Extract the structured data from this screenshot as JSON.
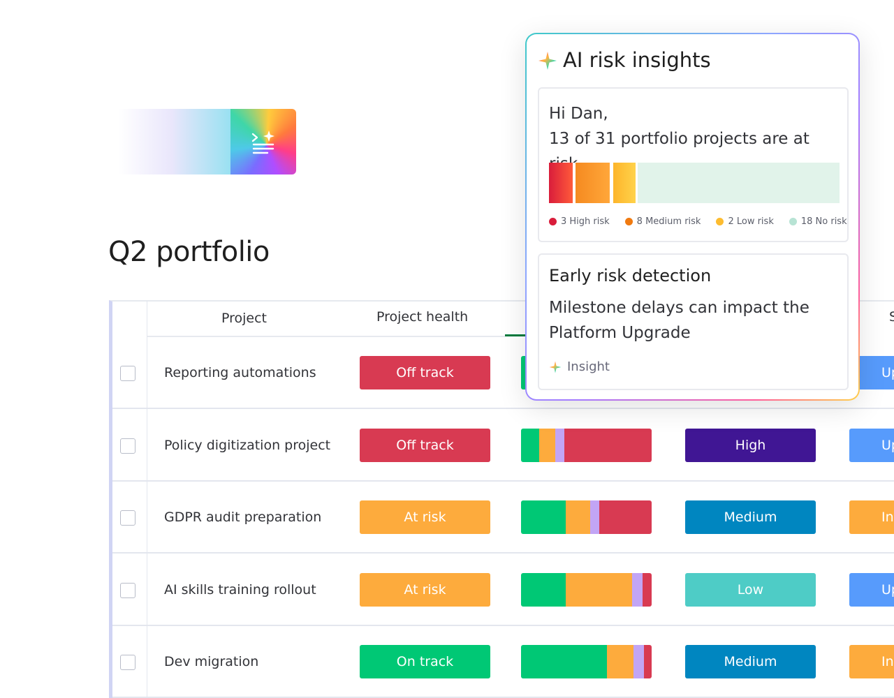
{
  "page": {
    "title": "Q2 portfolio"
  },
  "table": {
    "headers": {
      "project": "Project",
      "health": "Project health",
      "last": "S"
    },
    "rows": [
      {
        "name": "Reporting automations",
        "health": "Off track",
        "health_color": "#d83a52",
        "bar": [
          {
            "c": "#00c875",
            "w": 1
          }
        ],
        "priority": "",
        "priority_color": "",
        "status": "Up",
        "status_color": "#579bfc"
      },
      {
        "name": "Policy digitization project",
        "health": "Off track",
        "health_color": "#d83a52",
        "bar": [
          {
            "c": "#00c875",
            "w": 14
          },
          {
            "c": "#fdab3d",
            "w": 12
          },
          {
            "c": "#c2a5f5",
            "w": 7
          },
          {
            "c": "#d83a52",
            "w": 67
          }
        ],
        "priority": "High",
        "priority_color": "#401694",
        "status": "Up",
        "status_color": "#579bfc"
      },
      {
        "name": "GDPR audit preparation",
        "health": "At risk",
        "health_color": "#fdab3d",
        "bar": [
          {
            "c": "#00c875",
            "w": 34
          },
          {
            "c": "#fdab3d",
            "w": 19
          },
          {
            "c": "#c2a5f5",
            "w": 7
          },
          {
            "c": "#d83a52",
            "w": 40
          }
        ],
        "priority": "Medium",
        "priority_color": "#0086c0",
        "status": "In",
        "status_color": "#fdab3d"
      },
      {
        "name": "AI skills training rollout",
        "health": "At risk",
        "health_color": "#fdab3d",
        "bar": [
          {
            "c": "#00c875",
            "w": 34
          },
          {
            "c": "#fdab3d",
            "w": 51
          },
          {
            "c": "#c2a5f5",
            "w": 8
          },
          {
            "c": "#d83a52",
            "w": 7
          }
        ],
        "priority": "Low",
        "priority_color": "#4eccc6",
        "status": "Up",
        "status_color": "#579bfc"
      },
      {
        "name": "Dev migration",
        "health": "On track",
        "health_color": "#00c875",
        "bar": [
          {
            "c": "#00c875",
            "w": 66
          },
          {
            "c": "#fdab3d",
            "w": 20
          },
          {
            "c": "#c2a5f5",
            "w": 8
          },
          {
            "c": "#d83a52",
            "w": 6
          }
        ],
        "priority": "Medium",
        "priority_color": "#0086c0",
        "status": "In",
        "status_color": "#fdab3d"
      }
    ]
  },
  "panel": {
    "title": "AI risk insights",
    "greeting": "Hi Dan,",
    "summary": "13 of 31 portfolio projects are at risk.",
    "legend": [
      {
        "label": "3 High risk",
        "color": "#d91d3b"
      },
      {
        "label": "8 Medium risk",
        "color": "#f07a10"
      },
      {
        "label": "2 Low risk",
        "color": "#fdbc30"
      },
      {
        "label": "18 No risk",
        "color": "#b7e3d4"
      }
    ],
    "detection_title": "Early risk detection",
    "detection_body": "Milestone delays can impact the Platform Upgrade",
    "insight_label": "Insight"
  }
}
